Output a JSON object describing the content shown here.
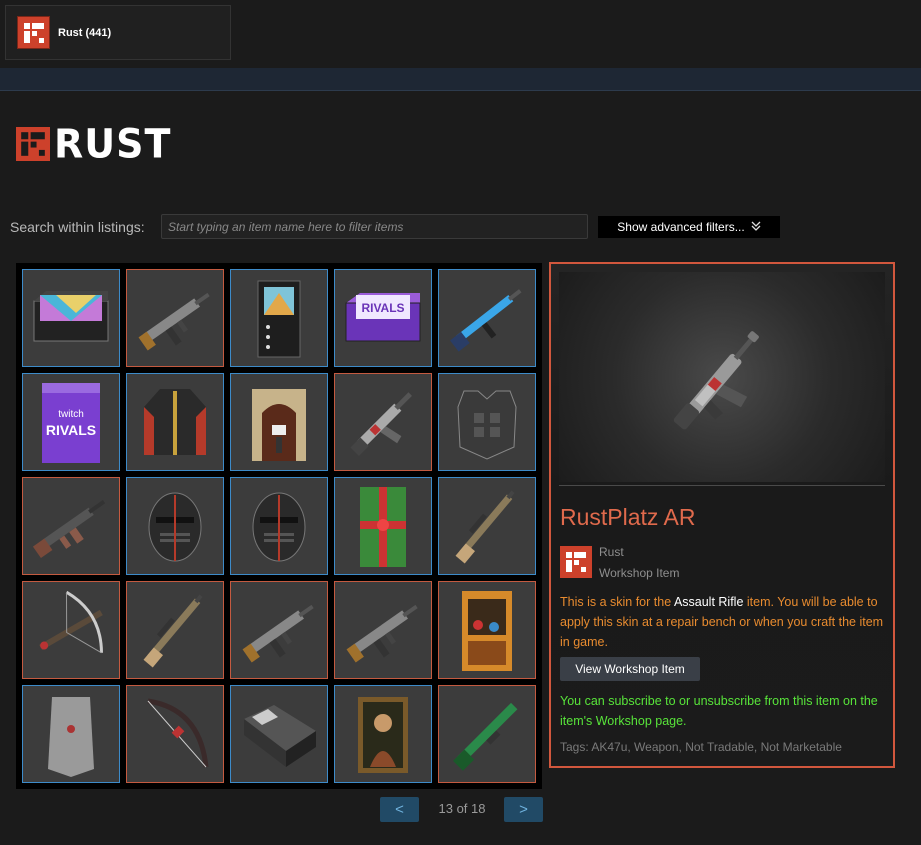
{
  "tab": {
    "label": "Rust (441)"
  },
  "logo": {
    "text": "RUST"
  },
  "search": {
    "label": "Search within listings:",
    "placeholder": "Start typing an item name here to filter items",
    "advanced_label": "Show advanced filters..."
  },
  "items": [
    {
      "icon": "storage-box-icon",
      "frame": "blue"
    },
    {
      "icon": "smg-icon",
      "frame": "red"
    },
    {
      "icon": "vending-machine-icon",
      "frame": "blue"
    },
    {
      "icon": "rivals-box-icon",
      "frame": "blue"
    },
    {
      "icon": "rifle-icon",
      "frame": "blue"
    },
    {
      "icon": "twitch-rivals-banner-icon",
      "frame": "blue"
    },
    {
      "icon": "jacket-icon",
      "frame": "blue"
    },
    {
      "icon": "arch-door-icon",
      "frame": "blue"
    },
    {
      "icon": "assault-rifle-icon",
      "frame": "red"
    },
    {
      "icon": "chestplate-icon",
      "frame": "blue"
    },
    {
      "icon": "thompson-icon",
      "frame": "red"
    },
    {
      "icon": "metal-facemask-icon",
      "frame": "blue"
    },
    {
      "icon": "metal-facemask-icon",
      "frame": "blue"
    },
    {
      "icon": "gift-door-icon",
      "frame": "blue"
    },
    {
      "icon": "bolt-rifle-icon",
      "frame": "blue"
    },
    {
      "icon": "crossbow-icon",
      "frame": "red"
    },
    {
      "icon": "bolt-rifle-icon",
      "frame": "red"
    },
    {
      "icon": "smg-icon",
      "frame": "red"
    },
    {
      "icon": "smg-icon",
      "frame": "red"
    },
    {
      "icon": "claw-machine-icon",
      "frame": "red"
    },
    {
      "icon": "cloth-sheet-icon",
      "frame": "blue"
    },
    {
      "icon": "bow-icon",
      "frame": "red"
    },
    {
      "icon": "bed-icon",
      "frame": "blue"
    },
    {
      "icon": "painting-icon",
      "frame": "blue"
    },
    {
      "icon": "shotgun-icon",
      "frame": "red"
    }
  ],
  "detail": {
    "title": "RustPlatz AR",
    "game_name": "Rust",
    "item_type": "Workshop Item",
    "desc_before": "This is a skin for the ",
    "desc_item": "Assault Rifle",
    "desc_after": " item. You will be able to apply this skin at a repair bench or when you craft the item in game.",
    "workshop_button": "View Workshop Item",
    "subscribe_note": "You can subscribe to or unsubscribe from this item on the item's Workshop page.",
    "tags": "Tags: AK47u, Weapon, Not Tradable, Not Marketable"
  },
  "pager": {
    "prev": "<",
    "next": ">",
    "text": "13 of 18"
  },
  "colors": {
    "accent_red": "#cd412b",
    "title_orange": "#e06a4c",
    "desc_orange": "#e88b2f",
    "subscribe_green": "#58e43a",
    "frame_blue": "#3d8bc9",
    "frame_red": "#c45a40"
  }
}
